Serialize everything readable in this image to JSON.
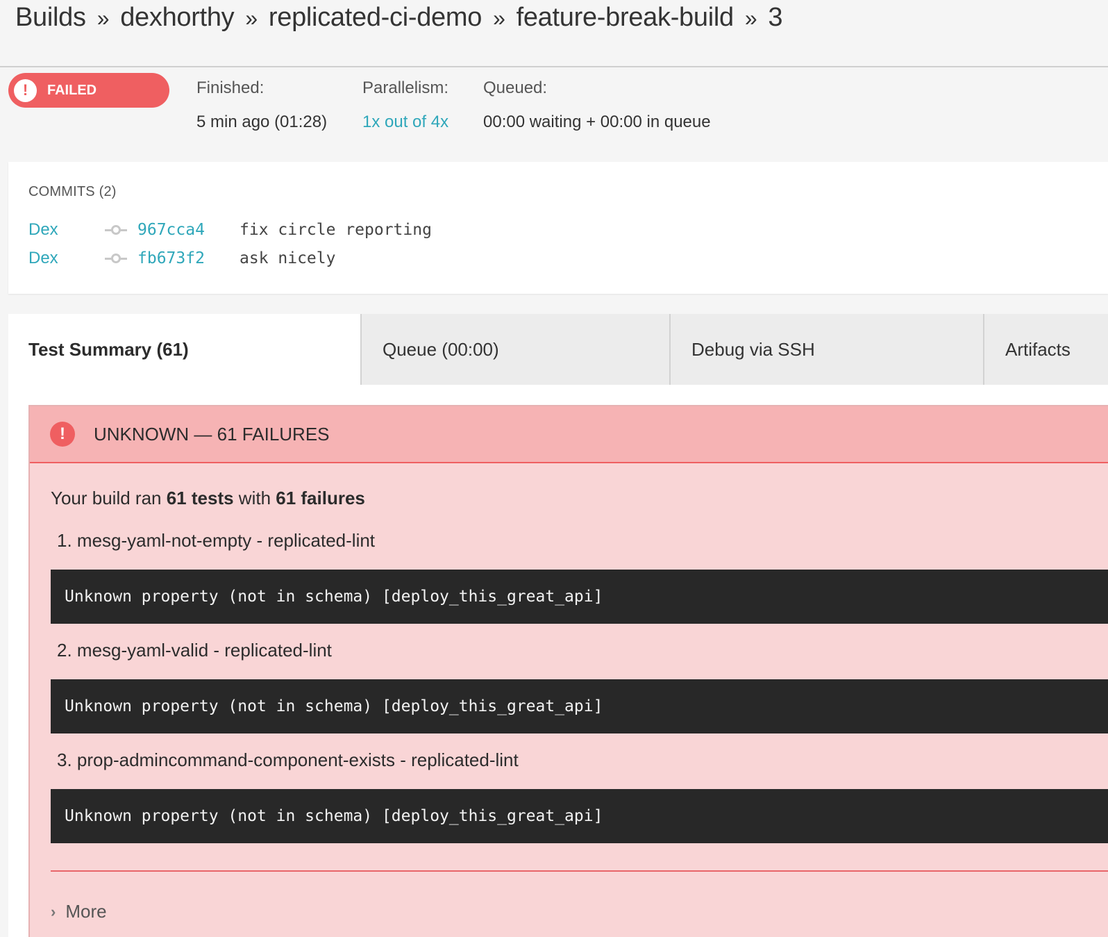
{
  "breadcrumb": {
    "items": [
      "Builds",
      "dexhorthy",
      "replicated-ci-demo",
      "feature-break-build",
      "3"
    ],
    "separator": "»"
  },
  "status": {
    "label": "FAILED",
    "icon": "exclamation-icon",
    "color": "#ef5f61"
  },
  "meta": {
    "finished": {
      "label": "Finished:",
      "value": "5 min ago (01:28)"
    },
    "parallelism": {
      "label": "Parallelism:",
      "value": "1x out of 4x"
    },
    "queued": {
      "label": "Queued:",
      "value": "00:00 waiting + 00:00 in queue"
    }
  },
  "commits": {
    "title": "COMMITS (2)",
    "items": [
      {
        "author": "Dex",
        "sha": "967cca4",
        "message": "fix circle reporting"
      },
      {
        "author": "Dex",
        "sha": "fb673f2",
        "message": "ask nicely"
      }
    ]
  },
  "tabs": [
    {
      "label": "Test Summary (61)",
      "active": true
    },
    {
      "label": "Queue (00:00)",
      "active": false
    },
    {
      "label": "Debug via SSH",
      "active": false
    },
    {
      "label": "Artifacts",
      "active": false
    }
  ],
  "failures": {
    "header": "UNKNOWN — 61 FAILURES",
    "summary": {
      "prefix": "Your build ran ",
      "tests": "61 tests",
      "middle": " with ",
      "failures": "61 failures"
    },
    "items": [
      {
        "name": "1. mesg-yaml-not-empty - replicated-lint",
        "output": "Unknown property (not in schema) [deploy_this_great_api]"
      },
      {
        "name": "2. mesg-yaml-valid - replicated-lint",
        "output": "Unknown property (not in schema) [deploy_this_great_api]"
      },
      {
        "name": "3. prop-admincommand-component-exists - replicated-lint",
        "output": "Unknown property (not in schema) [deploy_this_great_api]"
      }
    ],
    "more_label": "More"
  },
  "colors": {
    "accent": "#2fa7ba",
    "failed": "#ef5f61",
    "failure_header_bg": "#f6b3b4",
    "failure_body_bg": "#f9d5d6",
    "code_bg": "#282828"
  }
}
